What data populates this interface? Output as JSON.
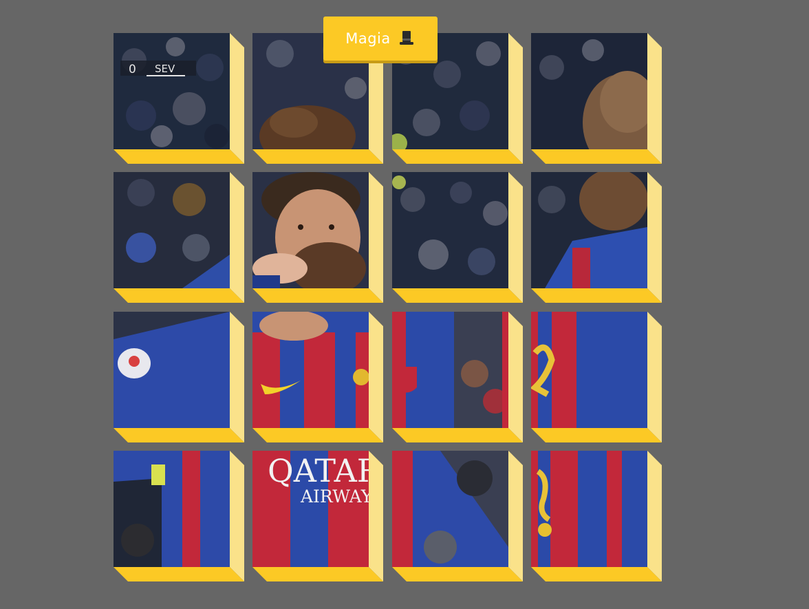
{
  "magic_button": {
    "label": "Magia",
    "icon": "top-hat-icon"
  },
  "colors": {
    "background": "#666666",
    "accent": "#fcc925",
    "accent_light": "#fae28a",
    "button_text": "#ffffff"
  },
  "puzzle": {
    "rows": 4,
    "cols": 4,
    "scoreboard_text": {
      "home": "0",
      "away": "SEV"
    },
    "shirt_sponsor": {
      "line1": "QATAR",
      "line2": "AIRWAYS"
    }
  }
}
